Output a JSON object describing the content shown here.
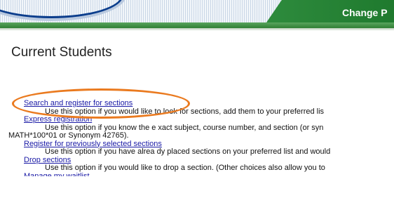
{
  "header": {
    "change_link": "Change P"
  },
  "page_title": "Current Students",
  "options": [
    {
      "link": "Search and register for sections",
      "description": "Use this option if you would like to look for sections, add them to your preferred lis"
    },
    {
      "link": "Express registration",
      "description": "Use this option if you know the e xact subject, course number, and section (or syn",
      "description_cont": "MATH*100*01 or Synonym 42765)."
    },
    {
      "link": "Register for previously selected sections",
      "description": "Use this option if you have alrea dy placed sections on your preferred list and would"
    },
    {
      "link": "Drop sections",
      "description": "Use this option if you would like to drop a section. (Other choices also allow you to"
    },
    {
      "link": "Manage my waitlist"
    }
  ],
  "colors": {
    "link": "#1a1aa6",
    "highlight": "#ea7a1f",
    "header_green": "#2e8b3d"
  }
}
